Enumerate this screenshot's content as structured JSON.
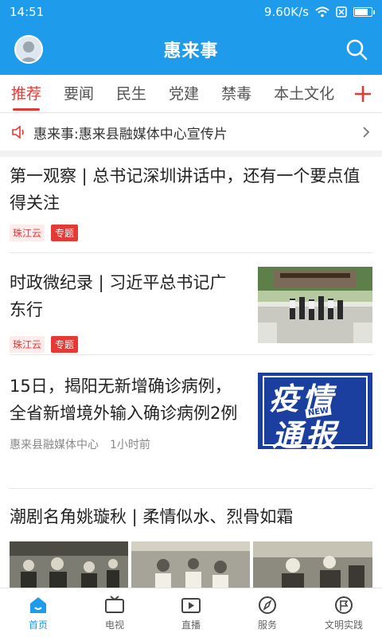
{
  "status_bar": {
    "time": "14:51",
    "network_speed": "9.60K/s"
  },
  "header": {
    "title": "惠来事"
  },
  "tabs": [
    {
      "label": "推荐"
    },
    {
      "label": "要闻"
    },
    {
      "label": "民生"
    },
    {
      "label": "党建"
    },
    {
      "label": "禁毒"
    },
    {
      "label": "本土文化"
    }
  ],
  "ticker": {
    "text": "惠来事:惠来县融媒体中心宣传片"
  },
  "articles": [
    {
      "headline": "第一观察 | 总书记深圳讲话中，还有一个要点值得关注",
      "source_tag": "珠江云",
      "topic_tag": "专题"
    },
    {
      "headline": "时政微纪录 | 习近平总书记广东行",
      "source_tag": "珠江云",
      "topic_tag": "专题"
    },
    {
      "headline": "15日，揭阳无新增确诊病例，全省新增境外输入确诊病例2例",
      "source": "惠来县融媒体中心",
      "time": "1小时前",
      "thumb_text_1": "疫情",
      "thumb_text_2": "通报",
      "thumb_badge": "NEW"
    },
    {
      "headline": "潮剧名角姚璇秋 | 柔情似水、烈骨如霜"
    }
  ],
  "bottom_nav": [
    {
      "label": "首页",
      "icon": "home-icon"
    },
    {
      "label": "电视",
      "icon": "tv-icon"
    },
    {
      "label": "直播",
      "icon": "video-icon"
    },
    {
      "label": "服务",
      "icon": "compass-icon"
    },
    {
      "label": "文明实践",
      "icon": "flag-icon"
    }
  ],
  "colors": {
    "primary": "#1e9bea",
    "accent": "#e53935"
  }
}
